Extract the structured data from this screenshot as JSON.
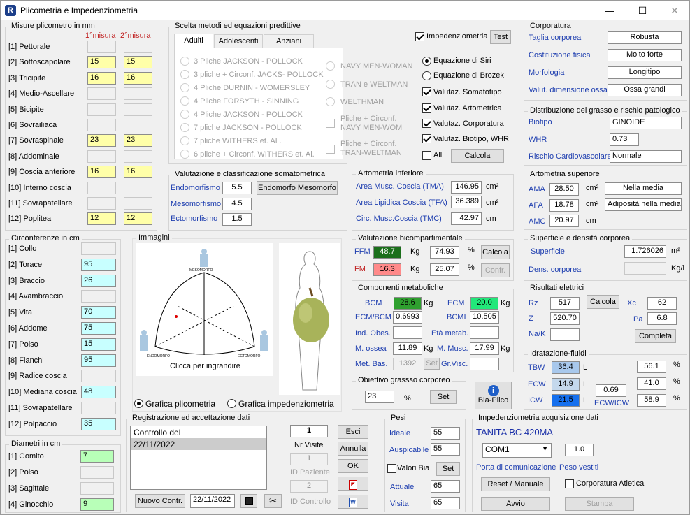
{
  "window": {
    "title": "Plicometria e Impedenziometria",
    "minimize": "—",
    "maximize": "☐",
    "close": "✕"
  },
  "plico": {
    "title": "Misure plicometro in mm",
    "h1": "1°misura",
    "h2": "2°misura",
    "rows": [
      {
        "label": "[1]  Pettorale",
        "v1": "",
        "v2": ""
      },
      {
        "label": "[2]  Sottoscapolare",
        "v1": "15",
        "v2": "15"
      },
      {
        "label": "[3]  Tricipite",
        "v1": "16",
        "v2": "16"
      },
      {
        "label": "[4]  Medio-Ascellare",
        "v1": "",
        "v2": ""
      },
      {
        "label": "[5]  Bicipite",
        "v1": "",
        "v2": ""
      },
      {
        "label": "[6]  Sovrailiaca",
        "v1": "",
        "v2": ""
      },
      {
        "label": "[7]  Sovraspinale",
        "v1": "23",
        "v2": "23"
      },
      {
        "label": "[8]  Addominale",
        "v1": "",
        "v2": ""
      },
      {
        "label": "[9]  Coscia anteriore",
        "v1": "16",
        "v2": "16"
      },
      {
        "label": "[10]  Interno coscia",
        "v1": "",
        "v2": ""
      },
      {
        "label": "[11]  Sovrapatellare",
        "v1": "",
        "v2": ""
      },
      {
        "label": "[12]  Poplitea",
        "v1": "12",
        "v2": "12"
      }
    ]
  },
  "circ": {
    "title": "Circonferenze in cm",
    "rows": [
      {
        "label": "[1]  Collo",
        "v": ""
      },
      {
        "label": "[2]  Torace",
        "v": "95"
      },
      {
        "label": "[3]  Braccio",
        "v": "26"
      },
      {
        "label": "[4]  Avambraccio",
        "v": ""
      },
      {
        "label": "[5]  Vita",
        "v": "70"
      },
      {
        "label": "[6]  Addome",
        "v": "75"
      },
      {
        "label": "[7]  Polso",
        "v": "15"
      },
      {
        "label": "[8]  Fianchi",
        "v": "95"
      },
      {
        "label": "[9]  Radice coscia",
        "v": ""
      },
      {
        "label": "[10]  Mediana coscia",
        "v": "48"
      },
      {
        "label": "[11]  Sovrapatellare",
        "v": ""
      },
      {
        "label": "[12]  Polpaccio",
        "v": "35"
      }
    ]
  },
  "diam": {
    "title": "Diametri in cm",
    "rows": [
      {
        "label": "[1]  Gomito",
        "v": "7"
      },
      {
        "label": "[2]  Polso",
        "v": ""
      },
      {
        "label": "[3]  Sagittale",
        "v": ""
      },
      {
        "label": "[4]  Ginocchio",
        "v": "9"
      }
    ]
  },
  "metodi": {
    "title": "Scelta metodi ed equazioni predittive",
    "tabs": [
      "Adulti",
      "Adolescenti",
      "Anziani"
    ],
    "left": [
      "3 Pliche JACKSON - POLLOCK",
      "3 pliche + Circonf. JACKS- POLLOCK",
      "4 Pliche DURNIN - WOMERSLEY",
      "4 Pliche FORSYTH - SINNING",
      "4 Pliche JACKSON - POLLOCK",
      "7 pliche  JACKSON - POLLOCK",
      "7 pliche WITHERS et. AL.",
      "6 pliche + Circonf. WITHERS et. Al."
    ],
    "right": [
      "NAVY MEN-WOMAN",
      "TRAN e WELTMAN",
      "WELTHMAN"
    ],
    "checks": [
      [
        "Pliche + Circonf.",
        "NAVY MEN-WOM"
      ],
      [
        "Pliche + Circonf.",
        "TRAN-WELTMAN"
      ]
    ]
  },
  "opts": {
    "impedenziometria": "Impedenziometria",
    "test": "Test",
    "siri": "Equazione di  Siri",
    "brozek": "Equazione di Brozek",
    "somato": "Valutaz. Somatotipo",
    "artro": "Valutaz. Artometrica",
    "corpo": "Valutaz. Corporatura",
    "biotipo": "Valutaz. Biotipo, WHR",
    "all": "All",
    "calcola": "Calcola"
  },
  "corporatura": {
    "title": "Corporatura",
    "rows": [
      {
        "label": "Taglia corporea",
        "v": "Robusta"
      },
      {
        "label": "Costituzione fisica",
        "v": "Molto forte"
      },
      {
        "label": "Morfologia",
        "v": "Longitipo"
      },
      {
        "label": "Valut. dimensione ossa",
        "v": "Ossa grandi"
      }
    ]
  },
  "distrib": {
    "title": "Distribuzione del grasso e rischio patologico",
    "biotipo_l": "Biotipo",
    "biotipo": "GINOIDE",
    "whr_l": "WHR",
    "whr": "0.73",
    "rischio_l": "Rischio Cardiovascolare",
    "rischio": "Normale"
  },
  "somato": {
    "title": "Valutazione e classificazione somatometrica",
    "endo_l": "Endomorfismo",
    "endo": "5.5",
    "meso_l": "Mesomorfismo",
    "meso": "4.5",
    "ecto_l": "Ectomorfismo",
    "ecto": "1.5",
    "btn": "Endomorfo Mesomorfo"
  },
  "artinf": {
    "title": "Artometria inferiore",
    "tma_l": "Area Musc. Coscia (TMA)",
    "tma": "146.95",
    "tma_u": "cm²",
    "tfa_l": "Area Lipidica Coscia (TFA)",
    "tfa": "36.389",
    "tfa_u": "cm²",
    "tmc_l": "Circ. Musc.Coscia (TMC)",
    "tmc": "42.97",
    "tmc_u": "cm"
  },
  "artsup": {
    "title": "Artometria superiore",
    "ama_l": "AMA",
    "ama": "28.50",
    "ama_u": "cm²",
    "ama_v": "Nella media",
    "afa_l": "AFA",
    "afa": "18.78",
    "afa_u": "cm²",
    "afa_v": "Adiposità nella media",
    "amc_l": "AMC",
    "amc": "20.97",
    "amc_u": "cm"
  },
  "immagini": {
    "title": "Immagini",
    "somatochart": "MESOMORFO",
    "caption": "Clicca per ingrandire",
    "r1": "Grafica plicometria",
    "r2": "Grafica impedenziometria",
    "endo_ax": "ENDOMORFO",
    "ecto_ax": "ECTOMORFO"
  },
  "bicomp": {
    "title": "Valutazione bicompartimentale",
    "ffm_l": "FFM",
    "ffm": "48.7",
    "ffm_u": "Kg",
    "ffm_p": "74.93",
    "fm_l": "FM",
    "fm": "16.3",
    "fm_u": "Kg",
    "fm_p": "25.07",
    "pct": "%",
    "calcola": "Calcola",
    "confr": "Confr."
  },
  "superficie": {
    "title": "Superficie e densità corporea",
    "sup_l": "Superficie",
    "sup": "1.726026",
    "sup_u": "m²",
    "dens_l": "Dens. corporea",
    "dens": "",
    "dens_u": "Kg/l"
  },
  "metab": {
    "title": "Componenti metaboliche",
    "bcm_l": "BCM",
    "bcm": "28.6",
    "kg": "Kg",
    "ecm_l": "ECM",
    "ecm": "20.0",
    "ecmbcm_l": "ECM/BCM",
    "ecmbcm": "0.6993",
    "bcmi_l": "BCMI",
    "bcmi": "10.505",
    "obes_l": "Ind. Obes.",
    "obes": "",
    "eta_l": "Età metab.",
    "eta": "",
    "ossea_l": "M. ossea",
    "ossea": "11.89",
    "musc_l": "M. Musc.",
    "musc": "17.99",
    "metbas_l": "Met. Bas.",
    "metbas": "1392",
    "set": "Set",
    "grvisc_l": "Gr.Visc.",
    "grvisc": ""
  },
  "elettrici": {
    "title": "Risultati elettrici",
    "rz_l": "Rz",
    "rz": "517",
    "calcola": "Calcola",
    "xc_l": "Xc",
    "xc": "62",
    "z_l": "Z",
    "z": "520.70",
    "pa_l": "Pa",
    "pa": "6.8",
    "nak_l": "Na/K",
    "nak": "",
    "completa": "Completa"
  },
  "idrat": {
    "title": "Idratazione-fluidi",
    "tbw_l": "TBW",
    "tbw": "36.4",
    "tbw_p": "56.1",
    "ecw_l": "ECW",
    "ecw": "14.9",
    "ecw_p": "41.0",
    "icw_l": "ICW",
    "icw": "21.5",
    "icw_p": "58.9",
    "ratio": "0.69",
    "ratio_l": "ECW/ICW",
    "l": "L",
    "pct": "%"
  },
  "obiettivo": {
    "title": "Obiettivo grassso corporeo",
    "v": "23",
    "pct": "%",
    "set": "Set"
  },
  "biaplico": {
    "label": "Bia-Plico",
    "icon": "i"
  },
  "registr": {
    "title": "Registrazione ed accettazione dati",
    "list": [
      "Controllo del",
      "22/11/2022"
    ],
    "count": "1",
    "nrvisite": "Nr Visite",
    "idpaz_v": "1",
    "idpaz": "ID Paziente",
    "idctrl_v": "2",
    "idctrl": "ID Controllo",
    "esci": "Esci",
    "annulla": "Annulla",
    "ok": "OK",
    "nuovo": "Nuovo Contr.",
    "date": "22/11/2022"
  },
  "pesi": {
    "title": "Pesi",
    "ideale_l": "Ideale",
    "ideale": "55",
    "ausp_l": "Auspicabile",
    "ausp": "55",
    "bia_l": "Valori Bia",
    "set": "Set",
    "attuale_l": "Attuale",
    "attuale": "65",
    "visita_l": "Visita",
    "visita": "65"
  },
  "acq": {
    "title": "Impedenziometria acquisizione dati",
    "device": "TANITA BC 420MA",
    "port": "COM1",
    "porta_l": "Porta di comunicazione",
    "vestiti": "1.0",
    "vestiti_l": "Peso vestiti",
    "reset": "Reset / Manuale",
    "atletica": "Corporatura Atletica",
    "avvio": "Avvio",
    "stampa": "Stampa"
  }
}
